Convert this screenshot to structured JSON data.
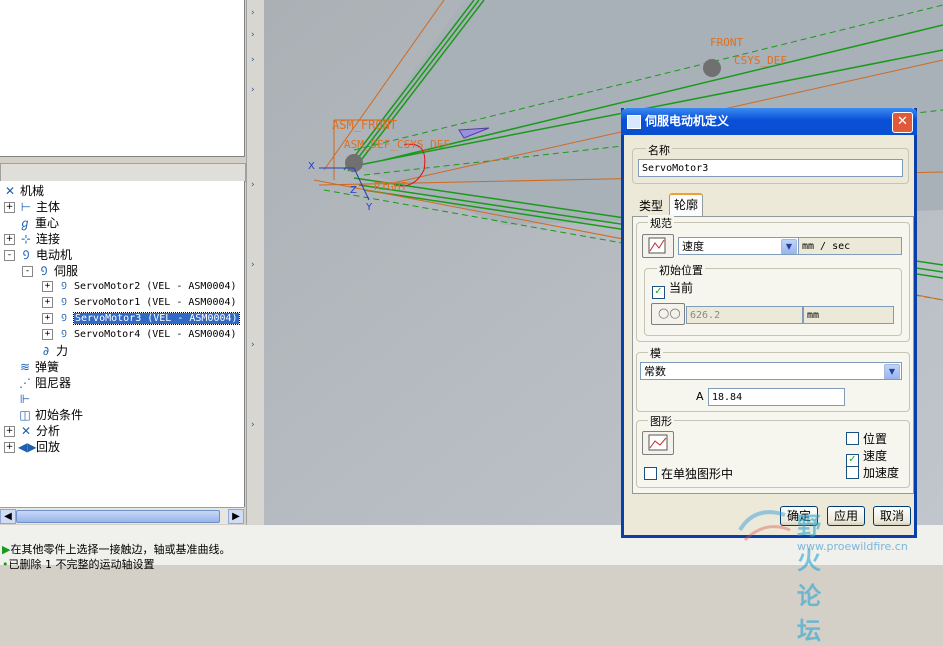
{
  "tree": {
    "items": [
      {
        "label": "机械",
        "icon": "mechanism-icon",
        "expander": ""
      },
      {
        "label": "主体",
        "icon": "body-icon",
        "expander": "+"
      },
      {
        "label": "重心",
        "icon": "gravity-icon",
        "expander": ""
      },
      {
        "label": "连接",
        "icon": "connection-icon",
        "expander": "+"
      },
      {
        "label": "电动机",
        "icon": "motor-icon",
        "expander": "-"
      },
      {
        "label": "伺服",
        "icon": "servo-icon",
        "expander": "-"
      },
      {
        "label": "ServoMotor2 (VEL - ASM0004)",
        "icon": "servo-motor-icon",
        "expander": "+"
      },
      {
        "label": "ServoMotor1 (VEL - ASM0004)",
        "icon": "servo-motor-icon",
        "expander": "+"
      },
      {
        "label": "ServoMotor3 (VEL - ASM0004)",
        "icon": "servo-motor-icon",
        "expander": "+",
        "selected": true
      },
      {
        "label": "ServoMotor4 (VEL - ASM0004)",
        "icon": "servo-motor-icon",
        "expander": "+"
      },
      {
        "label": "力",
        "icon": "force-icon",
        "expander": ""
      },
      {
        "label": "弹簧",
        "icon": "spring-icon",
        "expander": ""
      },
      {
        "label": "阻尼器",
        "icon": "damper-icon",
        "expander": ""
      },
      {
        "label": "",
        "icon": "belt-icon",
        "expander": ""
      },
      {
        "label": "初始条件",
        "icon": "initial-condition-icon",
        "expander": ""
      },
      {
        "label": "分析",
        "icon": "analysis-icon",
        "expander": "+"
      },
      {
        "label": "回放",
        "icon": "playback-icon",
        "expander": "+"
      }
    ]
  },
  "viewport": {
    "labels": {
      "asm_front": "ASM_FRONT",
      "csys_def": "ASM_DEF_CSYS_DEF",
      "right": "RIGHT",
      "front2": "FRONT",
      "csys_def2": "CSYS_DEF",
      "axis_x": "X",
      "axis_y": "Y",
      "axis_z": "Z"
    }
  },
  "status": {
    "line1": "在其他零件上选择一接触边，轴或基准曲线。",
    "line2": "已删除 1 不完整的运动轴设置"
  },
  "dialog": {
    "title": "伺服电动机定义",
    "name_group": "名称",
    "name_value": "ServoMotor3",
    "tabs": {
      "type": "类型",
      "profile": "轮廓"
    },
    "spec_group": "规范",
    "spec_value": "速度",
    "spec_unit": "mm / sec",
    "init_group": "初始位置",
    "current_label": "当前",
    "current_checked": true,
    "init_value": "626.2",
    "init_unit": "mm",
    "model_group": "模",
    "model_value": "常数",
    "a_label": "A",
    "a_value": "18.84",
    "graph_group": "图形",
    "separate_label": "在单独图形中",
    "position_label": "位置",
    "velocity_label": "速度",
    "accel_label": "加速度",
    "position_checked": false,
    "velocity_checked": true,
    "accel_checked": false,
    "separate_checked": false,
    "ok": "确定",
    "apply": "应用",
    "cancel": "取消"
  },
  "watermark": {
    "text": "野火论坛",
    "url": "www.proewildfire.cn"
  },
  "colors": {
    "title_blue": "#0a4fd8",
    "model_green": "#1a9a1a",
    "label_orange": "#e07020"
  }
}
